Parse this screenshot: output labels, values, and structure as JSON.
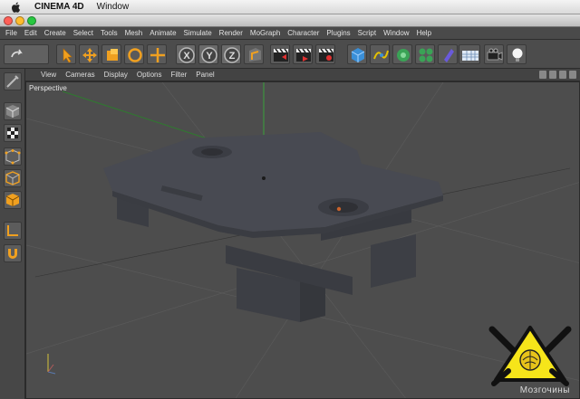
{
  "mac_menu": {
    "app_name": "CINEMA 4D",
    "items": [
      "Window"
    ]
  },
  "app_menu": [
    "File",
    "Edit",
    "Create",
    "Select",
    "Tools",
    "Mesh",
    "Animate",
    "Simulate",
    "Render",
    "MoGraph",
    "Character",
    "Plugins",
    "Script",
    "Window",
    "Help"
  ],
  "viewport_menu": [
    "View",
    "Cameras",
    "Display",
    "Options",
    "Filter",
    "Panel"
  ],
  "viewport": {
    "name": "Perspective"
  },
  "axis_buttons": [
    "X",
    "Y",
    "Z"
  ],
  "watermark": {
    "text": "Мозгочины"
  },
  "colors": {
    "accent_orange": "#f0a020",
    "axis_green": "#39a13c",
    "traffic_red": "#ff5f57",
    "traffic_yellow": "#febc2e",
    "traffic_green": "#28c840",
    "logo_yellow": "#f6e51a"
  }
}
